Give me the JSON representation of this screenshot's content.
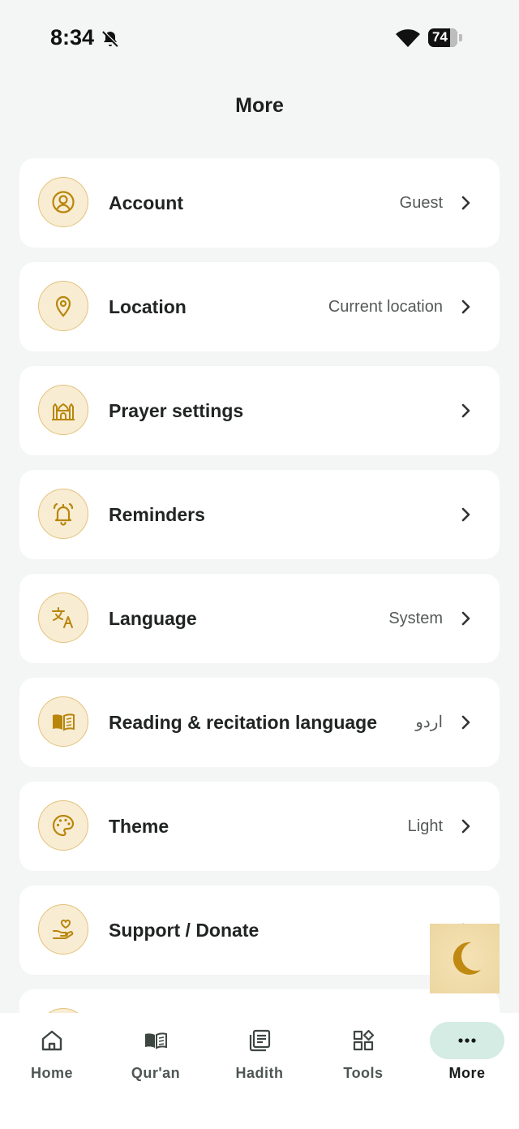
{
  "status_bar": {
    "time": "8:34",
    "battery": "74"
  },
  "header": {
    "title": "More"
  },
  "menu": [
    {
      "label": "Account",
      "value": "Guest",
      "icon": "account-icon"
    },
    {
      "label": "Location",
      "value": "Current location",
      "icon": "location-pin-icon"
    },
    {
      "label": "Prayer settings",
      "value": "",
      "icon": "mosque-icon"
    },
    {
      "label": "Reminders",
      "value": "",
      "icon": "alarm-bell-icon"
    },
    {
      "label": "Language",
      "value": "System",
      "icon": "translate-icon"
    },
    {
      "label": "Reading & recitation language",
      "value": "اردو",
      "icon": "open-book-icon"
    },
    {
      "label": "Theme",
      "value": "Light",
      "icon": "palette-icon"
    },
    {
      "label": "Support / Donate",
      "value": "",
      "icon": "donate-heart-hand-icon"
    }
  ],
  "nav": [
    {
      "label": "Home",
      "icon": "home-icon"
    },
    {
      "label": "Qur'an",
      "icon": "quran-book-icon"
    },
    {
      "label": "Hadith",
      "icon": "hadith-icon"
    },
    {
      "label": "Tools",
      "icon": "tools-grid-icon"
    },
    {
      "label": "More",
      "icon": "more-dots-icon",
      "active": true
    }
  ],
  "colors": {
    "accent": "#b8860b",
    "icon_bg": "#f8ecd3",
    "active_nav_bg": "#d5ece4",
    "page_bg": "#f3f6f5"
  }
}
